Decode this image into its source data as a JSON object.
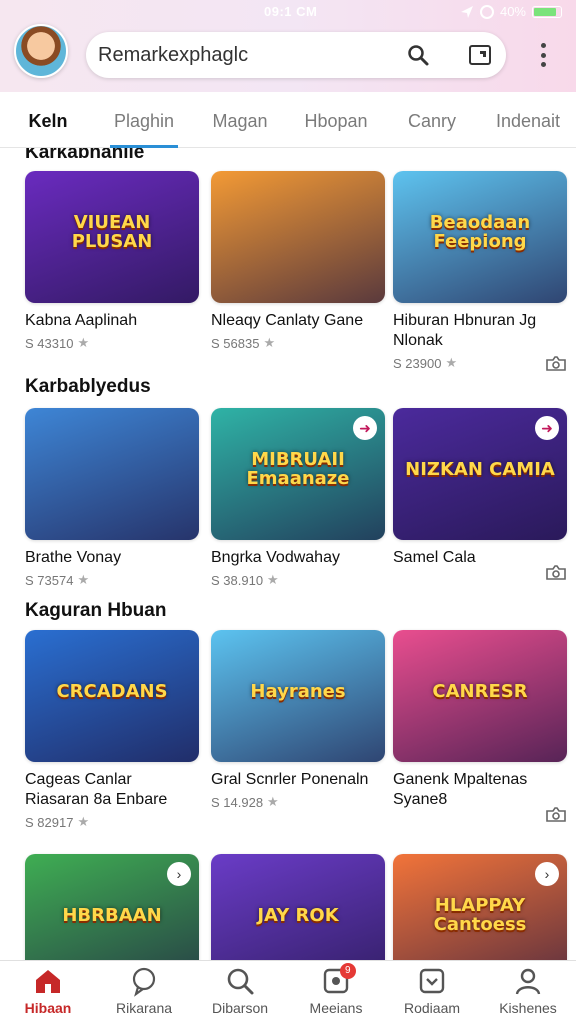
{
  "status": {
    "time": "09:1 CM",
    "battery": "40%"
  },
  "search": {
    "value": "Remarkexphaglc"
  },
  "tabs": [
    {
      "label": "Keln"
    },
    {
      "label": "Plaghin"
    },
    {
      "label": "Magan"
    },
    {
      "label": "Hbopan"
    },
    {
      "label": "Canry"
    },
    {
      "label": "Indenait"
    }
  ],
  "sections": [
    {
      "title": "Karkabhahile",
      "cards": [
        {
          "title": "Kabna Aaplinah",
          "meta": "S 43310",
          "art": "VIUEAN PLUSAN",
          "bg": "#6a2bbf"
        },
        {
          "title": "Nleaqy Canlaty Gane",
          "meta": "S 56835",
          "art": "",
          "bg": "#f39a35"
        },
        {
          "title": "Hiburan Hbnuran Jg Nlonak",
          "meta": "S 23900",
          "art": "Beaodaan Feepiong",
          "bg": "#5ec3ef"
        }
      ]
    },
    {
      "title": "Karbablyedus",
      "cards": [
        {
          "title": "Brathe Vonay",
          "meta": "S 73574",
          "art": "",
          "bg": "#3e86d6"
        },
        {
          "title": "Bngrka Vodwahay",
          "meta": "S 38.910",
          "art": "MIBRUAII Emaanaze",
          "bg": "#2fb3a6"
        },
        {
          "title": "Samel Cala",
          "meta": "",
          "art": "NIZKAN CAMIA",
          "bg": "#4b2a9c"
        }
      ]
    },
    {
      "title": "Kaguran Hbuan",
      "cards": [
        {
          "title": "Cageas Canlar Riasaran 8a Enbare",
          "meta": "S 82917",
          "art": "CRCADANS",
          "bg": "#2a6fd1"
        },
        {
          "title": "Gral Scnrler Ponenaln",
          "meta": "S 14.928",
          "art": "Hayranes",
          "bg": "#5cc3f0"
        },
        {
          "title": "Ganenk Mpaltenas Syane8",
          "meta": "",
          "art": "CANRESR",
          "bg": "#e94e8f"
        }
      ]
    },
    {
      "title": "",
      "cards": [
        {
          "title": "",
          "meta": "",
          "art": "HBRBAAN",
          "bg": "#3fae53"
        },
        {
          "title": "",
          "meta": "",
          "art": "JAY ROK",
          "bg": "#6a3cc7"
        },
        {
          "title": "",
          "meta": "",
          "art": "HLAPPAY Cantoess",
          "bg": "#f2743a"
        }
      ]
    }
  ],
  "bottom_nav": [
    {
      "label": "Hibaan",
      "icon": "home-icon"
    },
    {
      "label": "Rikarana",
      "icon": "chat-icon"
    },
    {
      "label": "Dibarson",
      "icon": "search-icon"
    },
    {
      "label": "Meeians",
      "icon": "games-icon",
      "badge": "9"
    },
    {
      "label": "Rodiaam",
      "icon": "library-icon"
    },
    {
      "label": "Kishenes",
      "icon": "profile-icon"
    }
  ]
}
